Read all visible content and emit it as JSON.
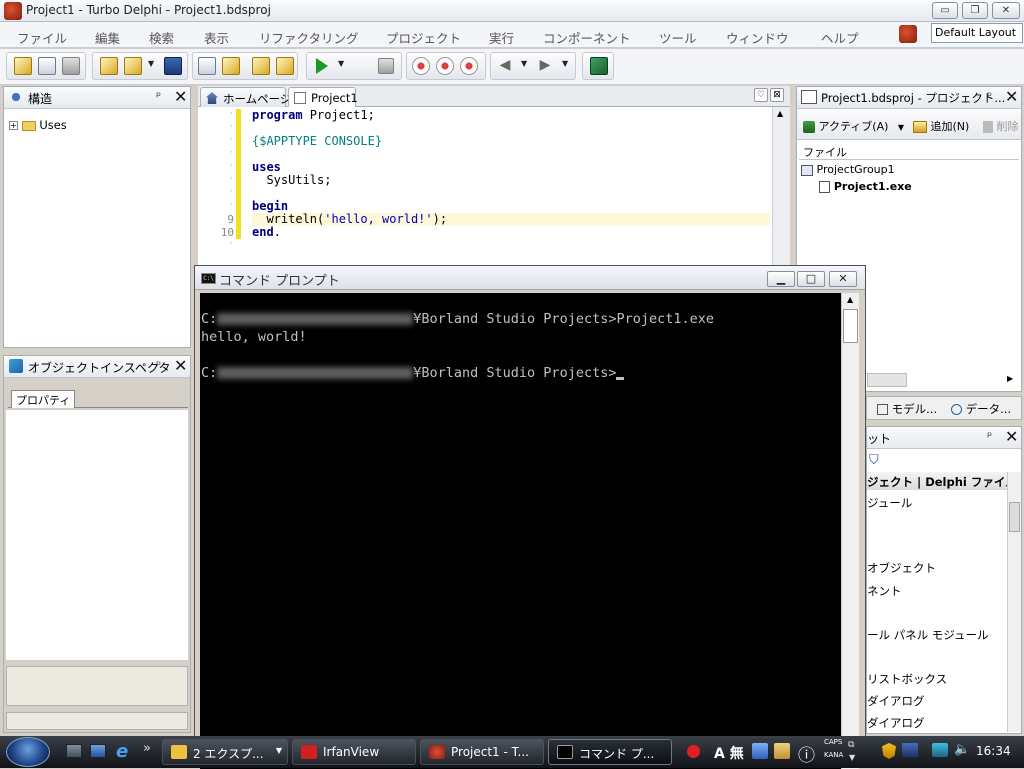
{
  "window": {
    "title": "Project1 - Turbo Delphi - Project1.bdsproj",
    "controls": {
      "minimize": "▭",
      "maximize": "❐",
      "close": "✕"
    }
  },
  "menubar": {
    "items": [
      "ファイル",
      "編集",
      "検索",
      "表示",
      "リファクタリング",
      "プロジェクト",
      "実行",
      "コンポーネント",
      "ツール",
      "ウィンドウ",
      "ヘルプ"
    ],
    "layout_select": "Default Layout"
  },
  "toolbar": {
    "icons": [
      "new-items-icon",
      "open-icon",
      "save-icon",
      "run-icon",
      "pause-icon",
      "stop-icon",
      "step-icon",
      "back-icon",
      "forward-icon",
      "help-book-icon"
    ]
  },
  "structure_panel": {
    "title": "構造",
    "tree": [
      {
        "expander": "+",
        "label": "Uses"
      }
    ]
  },
  "object_inspector": {
    "title": "オブジェクトインスペクタ",
    "tab": "プロパティ"
  },
  "editor": {
    "tabs": [
      "ホームページ",
      "Project1"
    ],
    "lines": [
      {
        "num": "",
        "segments": [
          {
            "t": "program",
            "c": "kw"
          },
          {
            "t": " Project1;",
            "c": ""
          }
        ]
      },
      {
        "num": "",
        "segments": []
      },
      {
        "num": "",
        "segments": [
          {
            "t": "{$APPTYPE CONSOLE}",
            "c": "dir"
          }
        ]
      },
      {
        "num": "",
        "segments": []
      },
      {
        "num": "",
        "segments": [
          {
            "t": "uses",
            "c": "kw"
          }
        ]
      },
      {
        "num": "",
        "segments": [
          {
            "t": "  SysUtils;",
            "c": ""
          }
        ]
      },
      {
        "num": "",
        "segments": []
      },
      {
        "num": "",
        "segments": [
          {
            "t": "begin",
            "c": "kw"
          }
        ]
      },
      {
        "num": "9",
        "segments": [
          {
            "t": "  writeln(",
            "c": ""
          },
          {
            "t": "'hello, world!'",
            "c": "str"
          },
          {
            "t": ");",
            "c": ""
          }
        ]
      },
      {
        "num": "10",
        "segments": [
          {
            "t": "end",
            "c": "kw"
          },
          {
            "t": ".",
            "c": ""
          }
        ]
      }
    ]
  },
  "project_manager": {
    "title": "Project1.bdsproj - プロジェクト...",
    "activate_label": "アクティブ(A)",
    "add_label": "追加(N)",
    "delete_label": "削除",
    "column_header": "ファイル",
    "tree": [
      "ProjectGroup1",
      "Project1.exe"
    ],
    "bottom_tabs": [
      "モデル...",
      "データ..."
    ]
  },
  "tool_palette": {
    "title": "ット",
    "category": "ジェクト | Delphi ファイル",
    "items": [
      "ジュール",
      "オブジェクト",
      "ネント",
      "ール パネル モジュール",
      "リストボックス",
      "ダイアログ",
      "ダイアログ"
    ]
  },
  "cmd_window": {
    "title": "コマンド プロンプト",
    "icon_text": "C:\\",
    "lines": [
      {
        "prefix": "C:",
        "suffix": "¥Borland Studio Projects>Project1.exe"
      },
      {
        "text": "hello, world!"
      },
      {
        "text": ""
      },
      {
        "prefix": "C:",
        "suffix": "¥Borland Studio Projects>"
      }
    ]
  },
  "taskbar": {
    "buttons": [
      "2 エクスプ...",
      "IrfanView",
      "Project1 - T...",
      "コマンド プ..."
    ],
    "active_index": 3,
    "tray": {
      "caps": "CAPS",
      "kana": "KANA",
      "clock": "16:34",
      "ime_mode": "A 無"
    }
  }
}
